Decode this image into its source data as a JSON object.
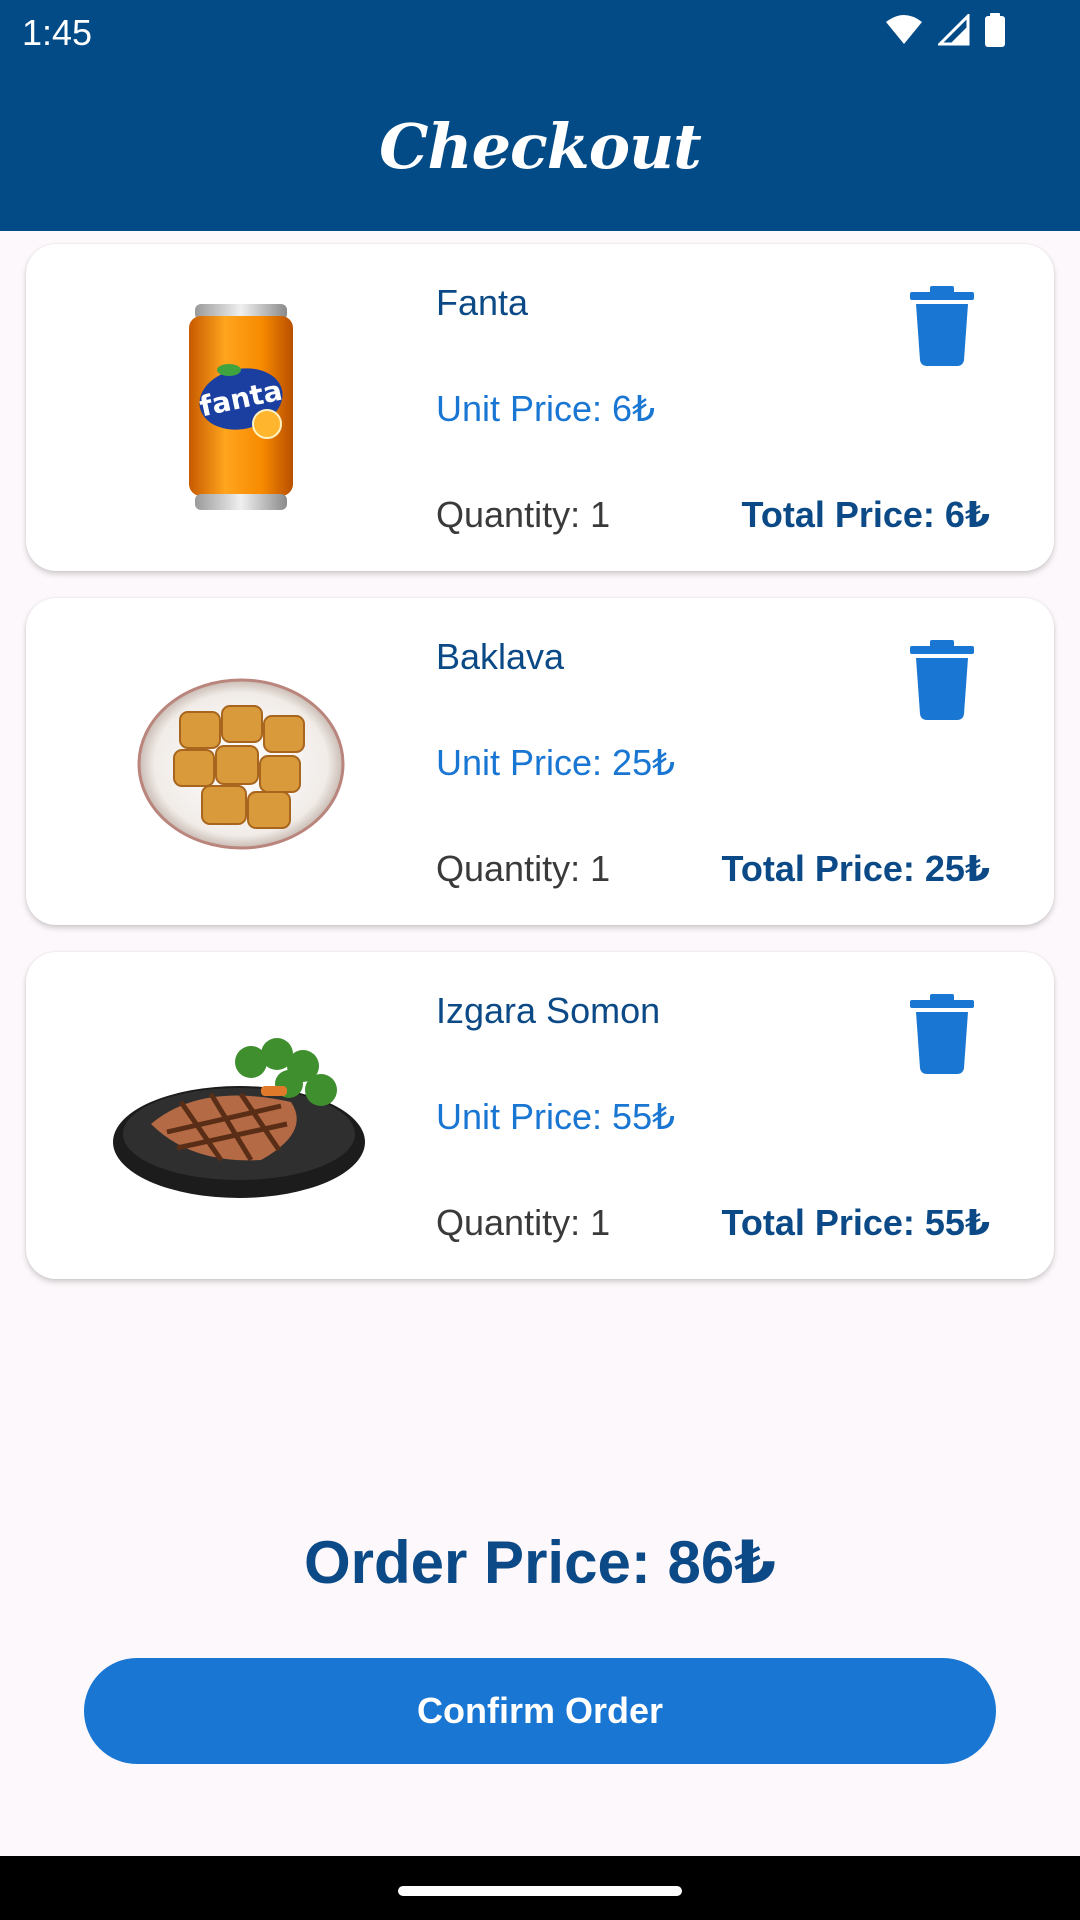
{
  "status_bar": {
    "time": "1:45",
    "icons": [
      "wifi-icon",
      "signal-icon",
      "battery-icon"
    ]
  },
  "header": {
    "title": "Checkout"
  },
  "cart_items": [
    {
      "name": "Fanta",
      "unit_price": "Unit Price: 6₺",
      "quantity": "Quantity: 1",
      "total_price": "Total Price: 6₺",
      "image": "fanta-can-image"
    },
    {
      "name": "Baklava",
      "unit_price": "Unit Price: 25₺",
      "quantity": "Quantity: 1",
      "total_price": "Total Price: 25₺",
      "image": "baklava-plate-image"
    },
    {
      "name": "Izgara Somon",
      "unit_price": "Unit Price: 55₺",
      "quantity": "Quantity: 1",
      "total_price": "Total Price: 55₺",
      "image": "grilled-salmon-image"
    }
  ],
  "summary": {
    "order_price": "Order Price: 86₺"
  },
  "actions": {
    "confirm_label": "Confirm Order"
  },
  "colors": {
    "primary_dark": "#034b87",
    "primary": "#1976d2",
    "background": "#fdf8fb"
  }
}
